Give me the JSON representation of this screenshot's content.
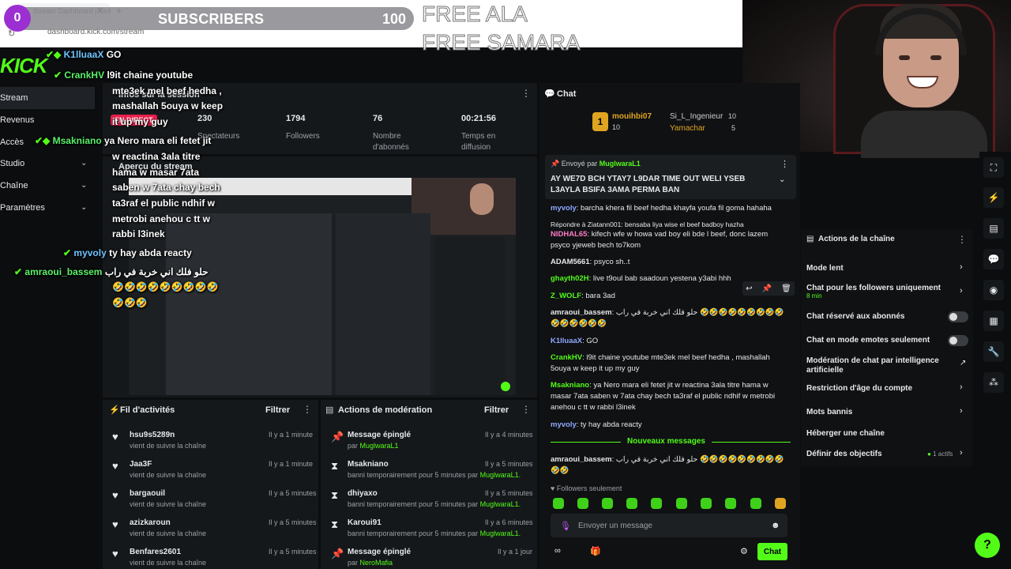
{
  "browser": {
    "tab_title": "Stream Dashboard | Kick",
    "url": "dashboard.kick.com/stream"
  },
  "overlay": {
    "sub_count_circle": "0",
    "subscribers_label": "SUBSCRIBERS",
    "subscribers_value": "100",
    "free_line1": "FREE ALA",
    "free_line2": "FREE SAMARA",
    "chat": [
      {
        "user": "K1lluaaX",
        "text": "GO"
      },
      {
        "user": "CrankHV",
        "text": "l9it chaine youtube"
      },
      {
        "user": "",
        "text": "mte3ek mel beef hedha ,"
      },
      {
        "user": "",
        "text": "mashallah 5ouya w keep"
      },
      {
        "user": "",
        "text": "it up my guy"
      },
      {
        "user": "Msakniano",
        "text": "ya Nero mara eli fetet jit"
      },
      {
        "user": "",
        "text": "w reactina 3ala titre"
      },
      {
        "user": "",
        "text": "hama w masar 7ata"
      },
      {
        "user": "",
        "text": "saben w 7ata chay bech"
      },
      {
        "user": "",
        "text": "ta3raf el public ndhif w"
      },
      {
        "user": "",
        "text": "metrobi anehou c tt w"
      },
      {
        "user": "",
        "text": "rabbi l3inek"
      },
      {
        "user": "myvoly",
        "text": "ty hay abda reacty"
      },
      {
        "user": "amraoui_bassem",
        "text": "حلو فلك اني خربة في راب"
      },
      {
        "user": "",
        "text": "🤣🤣🤣🤣🤣🤣🤣🤣🤣"
      },
      {
        "user": "",
        "text": "🤣🤣🤣"
      }
    ]
  },
  "sidebar": {
    "logo": "KICK",
    "items": [
      {
        "label": "Stream",
        "chevron": false
      },
      {
        "label": "Revenus",
        "chevron": false
      },
      {
        "label": "Accès",
        "chevron": false
      },
      {
        "label": "Studio",
        "chevron": true
      },
      {
        "label": "Chaîne",
        "chevron": true
      },
      {
        "label": "Paramètres",
        "chevron": true
      }
    ]
  },
  "session": {
    "title": "Infos sur la session",
    "live_badge": "EN DIRECT",
    "stats": [
      {
        "value": "230",
        "label": "Spectateurs"
      },
      {
        "value": "1794",
        "label": "Followers"
      },
      {
        "value": "76",
        "label": "Nombre d'abonnés"
      },
      {
        "value": "00:21:56",
        "label": "Temps en diffusion"
      }
    ]
  },
  "preview": {
    "title": "Aperçu du stream"
  },
  "activity": {
    "title": "Fil d'activités",
    "filter": "Filtrer",
    "rows": [
      {
        "name": "hsu9s5289n",
        "sub": "vient de suivre la chaîne",
        "time": "Il y a 1 minute"
      },
      {
        "name": "Jaa3F",
        "sub": "vient de suivre la chaîne",
        "time": "Il y a 1 minute"
      },
      {
        "name": "bargaouil",
        "sub": "vient de suivre la chaîne",
        "time": "Il y a 5 minutes"
      },
      {
        "name": "azizkaroun",
        "sub": "vient de suivre la chaîne",
        "time": "Il y a 5 minutes"
      },
      {
        "name": "Benfares2601",
        "sub": "vient de suivre la chaîne",
        "time": "Il y a 5 minutes"
      }
    ]
  },
  "moderation": {
    "title": "Actions de modération",
    "filter": "Filtrer",
    "rows": [
      {
        "icon": "pin",
        "name": "Message épinglé",
        "sub": "par ",
        "by": "MuglwaraL1",
        "time": "Il y a 4 minutes"
      },
      {
        "icon": "hourglass",
        "name": "Msakniano",
        "sub": "banni temporairement pour 5 minutes par ",
        "by": "MuglwaraL1.",
        "time": "Il y a 5 minutes"
      },
      {
        "icon": "hourglass",
        "name": "dhiyaxo",
        "sub": "banni temporairement pour 5 minutes par ",
        "by": "MuglwaraL1.",
        "time": "Il y a 5 minutes"
      },
      {
        "icon": "hourglass",
        "name": "Karoui91",
        "sub": "banni temporairement pour 5 minutes par ",
        "by": "MuglwaraL1.",
        "time": "Il y a 6 minutes"
      },
      {
        "icon": "pin",
        "name": "Message épinglé",
        "sub": "par ",
        "by": "NeroMafia",
        "time": "Il y a 1 jour"
      }
    ]
  },
  "chat": {
    "title": "Chat",
    "top_user1": "mouihbi07",
    "top_user1_count": "10",
    "top_user2": "Si_L_Ingenieur",
    "top_user2_count": "10",
    "top_user3": "Yamachar",
    "top_user3_count": "5",
    "pinned_prefix": "Envoyé par",
    "pinned_by": "MuglwaraL1",
    "pinned_text": "AY WE7D BCH YTAY7 L9DAR TIME OUT WELI YSEB L3AYLA BSIFA 3AMA PERMA BAN",
    "messages": [
      {
        "user": "myvoly",
        "cls": "u-blue",
        "text": "barcha khera fil beef hedha khayfa youfa fil goma hahaha"
      },
      {
        "user": "",
        "cls": "muted",
        "text": "Répondre à Ziatann001: bensaba liya wise el beef badboy hazha"
      },
      {
        "user": "NIDHAL65",
        "cls": "u-pink",
        "text": "kifech wfe w howa vad boy eli bde l beef, donc lazem psyco yjeweb bech to7kom"
      },
      {
        "user": "ADAM5661",
        "cls": "u-white",
        "text": "psyco sh..t"
      },
      {
        "user": "ghayth02H",
        "cls": "u-green",
        "text": "live t9oul bab saadoun yestena y3abi hhh"
      },
      {
        "user": "Z_WOLF",
        "cls": "u-green",
        "text": "bara 3ad"
      },
      {
        "user": "amraoui_bassem",
        "cls": "u-white",
        "text": "حلو فلك اني خربة في راب 🤣🤣🤣🤣🤣🤣🤣🤣🤣🤣🤣🤣🤣🤣🤣"
      },
      {
        "user": "K1lluaaX",
        "cls": "u-blue",
        "text": "GO"
      },
      {
        "user": "CrankHV",
        "cls": "u-green",
        "text": "l9it chaine youtube mte3ek mel beef hedha , mashallah 5ouya w keep it up my guy"
      },
      {
        "user": "Msakniano",
        "cls": "u-green",
        "text": "ya Nero mara eli fetet jit w reactina 3ala titre hama w masar 7ata saben w 7ata chay bech ta3raf el public ndhif w metrobi anehou c tt w rabbi l3inek"
      },
      {
        "user": "myvoly",
        "cls": "u-blue",
        "text": "ty hay abda reacty"
      },
      {
        "user": "amraoui_bassem",
        "cls": "u-white",
        "text": "حلو فلك اني خربة في راب 🤣🤣🤣🤣🤣🤣🤣🤣🤣🤣🤣"
      }
    ],
    "new_messages": "Nouveaux messages",
    "followers_only": "Followers seulement",
    "input_placeholder": "Envoyer un message",
    "send": "Chat"
  },
  "actions": {
    "title": "Actions de la chaîne",
    "items": [
      {
        "label": "Mode lent",
        "type": "chevron"
      },
      {
        "label": "Chat pour les followers uniquement",
        "sub": "8 min",
        "type": "chevron"
      },
      {
        "label": "Chat réservé aux abonnés",
        "type": "toggle"
      },
      {
        "label": "Chat en mode emotes seulement",
        "type": "toggle"
      },
      {
        "label": "Modération de chat par intelligence artificielle",
        "type": "external"
      },
      {
        "label": "Restriction d'âge du compte",
        "type": "chevron"
      },
      {
        "label": "Mots bannis",
        "type": "chevron"
      },
      {
        "label": "Héberger une chaîne",
        "type": "none"
      },
      {
        "label": "Définir des objectifs",
        "sub_right": "1 actifs",
        "type": "chevron"
      }
    ]
  },
  "colors": {
    "brand": "#53fc18",
    "panel": "#15181b",
    "bg": "#0b0d0f"
  }
}
